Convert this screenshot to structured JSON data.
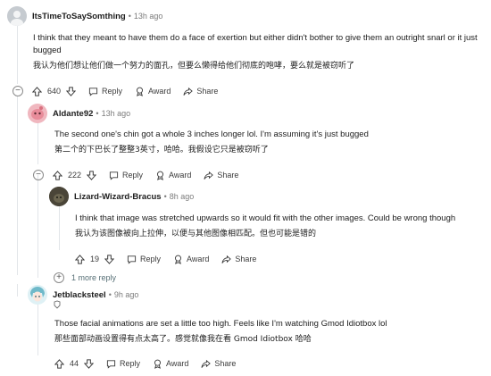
{
  "comments": [
    {
      "username": "ItsTimeToSaySomthing",
      "time": "13h ago",
      "text_en": "I think that they meant to have them do a face of exertion but either didn't bother to give them an outright snarl or it just bugged",
      "text_cn": "我认为他们想让他们做一个努力的面孔，但要么懒得给他们彻底的咆哮，要么就是被窃听了",
      "votes": "640",
      "reply": "Reply",
      "award": "Award",
      "share": "Share"
    },
    {
      "username": "Aldante92",
      "time": "13h ago",
      "text_en": "The second one's chin got a whole 3 inches longer lol. I'm assuming it's just bugged",
      "text_cn": "第二个的下巴长了整整3英寸，哈哈。我假设它只是被窃听了",
      "votes": "222",
      "reply": "Reply",
      "award": "Award",
      "share": "Share"
    },
    {
      "username": "Lizard-Wizard-Bracus",
      "time": "8h ago",
      "text_en": "I think that image was stretched upwards so it would fit with the other images. Could be wrong though",
      "text_cn": "我认为该图像被向上拉伸，以便与其他图像相匹配。但也可能是错的",
      "votes": "19",
      "reply": "Reply",
      "award": "Award",
      "share": "Share"
    },
    {
      "username": "Jetblacksteel",
      "time": "9h ago",
      "text_en": "Those facial animations are set a little too high. Feels like I'm watching Gmod Idiotbox lol",
      "text_cn": "那些面部动画设置得有点太高了。感觉就像我在看 Gmod Idiotbox 哈哈",
      "votes": "44",
      "reply": "Reply",
      "award": "Award",
      "share": "Share"
    }
  ],
  "more_replies": "1 more reply",
  "colors": {
    "aldante_avatar": "#e8a0a8",
    "jet_avatar": "#8ec9d6"
  },
  "icons": [
    "upvote-icon",
    "downvote-icon",
    "reply-bubble-icon",
    "award-icon",
    "share-icon",
    "collapse-icon",
    "expand-icon",
    "avatar",
    "flair-icon"
  ]
}
